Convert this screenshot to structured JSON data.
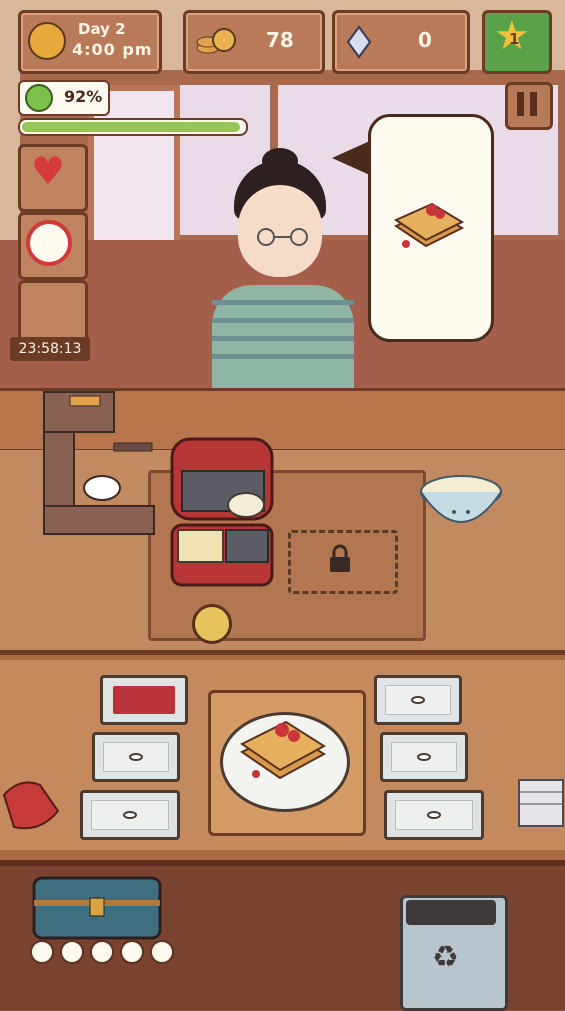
{
  "hud": {
    "day": "Day 2",
    "time": "4:00 pm",
    "coins": "78",
    "gems": "0",
    "level": "1",
    "satisfaction": "92%",
    "patience_fraction": 0.98
  },
  "side_panel": {
    "boost_timer": "23:58:13"
  },
  "order": {
    "item": "strawberry waffle"
  },
  "progress": {
    "dots_total": 5,
    "dots_filled": 0
  },
  "icons": {
    "sun": "sun-icon",
    "coin": "coin-stack-icon",
    "gem": "gem-icon",
    "star": "star-icon",
    "heart": "heart-icon",
    "no_ads": "no-ads-icon",
    "pause": "pause-icon",
    "lock": "lock-icon",
    "recycle": "recycle-icon"
  },
  "colors": {
    "patience_fill": "#94c657",
    "star_green": "#5aa24a",
    "heart_red": "#d53b3b"
  }
}
